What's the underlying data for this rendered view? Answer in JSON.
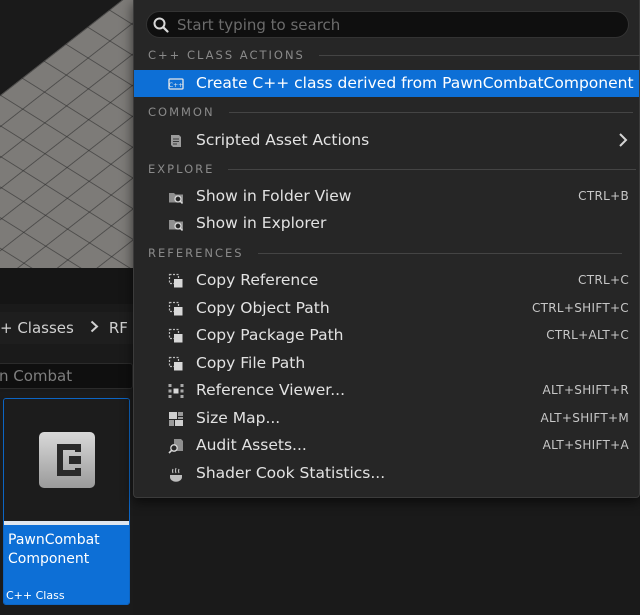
{
  "background": {
    "content_browser": {
      "path_segments": [
        "+ Classes",
        "RF"
      ],
      "search_value": "n Combat",
      "asset": {
        "name": "PawnCombat Component",
        "type": "C++ Class",
        "icon": "cpp-class-icon"
      }
    }
  },
  "menu": {
    "search": {
      "placeholder": "Start typing to search",
      "value": ""
    },
    "sections": [
      {
        "header": "C++ CLASS ACTIONS",
        "items": [
          {
            "label": "Create C++ class derived from PawnCombatComponent",
            "icon": "cpp-class-icon",
            "shortcut": "",
            "highlighted": true
          }
        ]
      },
      {
        "header": "COMMON",
        "items": [
          {
            "label": "Scripted Asset Actions",
            "icon": "scroll-icon",
            "shortcut": "",
            "submenu": true
          }
        ]
      },
      {
        "header": "EXPLORE",
        "items": [
          {
            "label": "Show in Folder View",
            "icon": "folder-search-icon",
            "shortcut": "CTRL+B"
          },
          {
            "label": "Show in Explorer",
            "icon": "folder-search-icon",
            "shortcut": ""
          }
        ]
      },
      {
        "header": "REFERENCES",
        "items": [
          {
            "label": "Copy Reference",
            "icon": "copy-icon",
            "shortcut": "CTRL+C"
          },
          {
            "label": "Copy Object Path",
            "icon": "copy-icon",
            "shortcut": "CTRL+SHIFT+C"
          },
          {
            "label": "Copy Package Path",
            "icon": "copy-icon",
            "shortcut": "CTRL+ALT+C"
          },
          {
            "label": "Copy File Path",
            "icon": "copy-icon",
            "shortcut": ""
          },
          {
            "label": "Reference Viewer...",
            "icon": "reference-viewer-icon",
            "shortcut": "ALT+SHIFT+R"
          },
          {
            "label": "Size Map...",
            "icon": "size-map-icon",
            "shortcut": "ALT+SHIFT+M"
          },
          {
            "label": "Audit Assets...",
            "icon": "audit-icon",
            "shortcut": "ALT+SHIFT+A"
          },
          {
            "label": "Shader Cook Statistics...",
            "icon": "shader-cook-icon",
            "shortcut": ""
          }
        ]
      }
    ]
  },
  "colors": {
    "accent": "#0d6fd6",
    "menu_bg": "#262626",
    "text": "#e2e2e2",
    "header_text": "#8a8a8a"
  }
}
